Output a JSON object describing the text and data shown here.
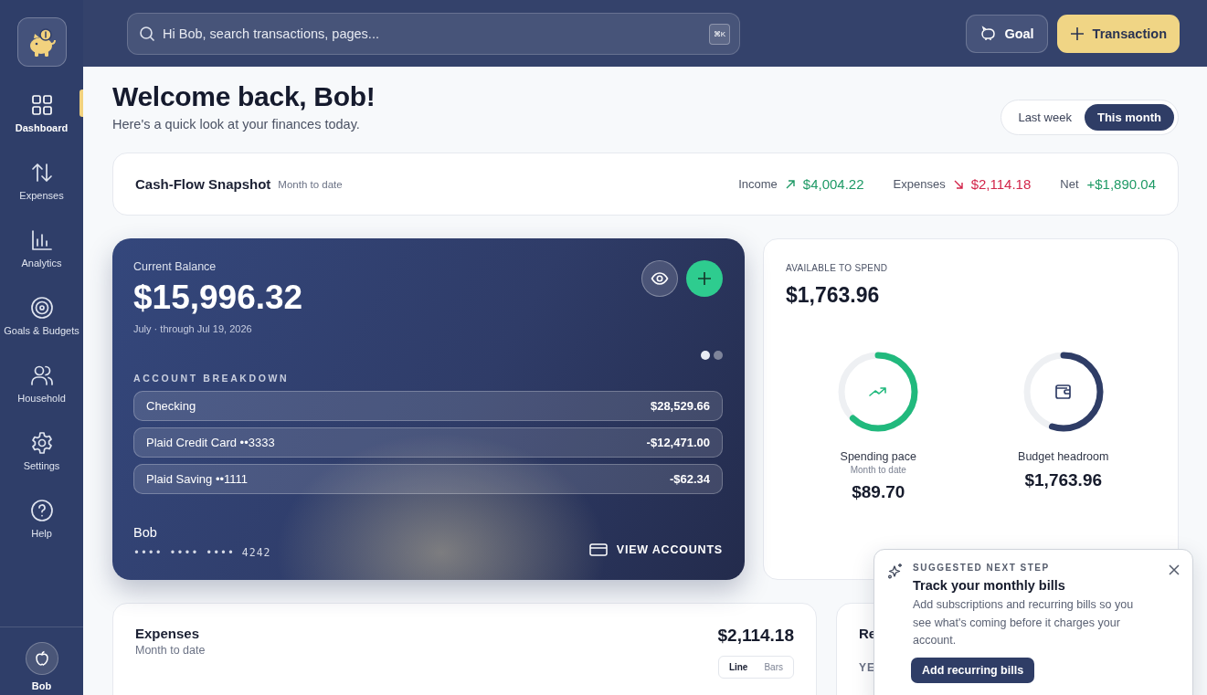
{
  "sidebar": {
    "items": [
      {
        "label": "Dashboard",
        "kind": "grid",
        "selected": true
      },
      {
        "label": "Expenses",
        "kind": "arrows",
        "selected": false
      },
      {
        "label": "Analytics",
        "kind": "chart",
        "selected": false
      },
      {
        "label": "Goals & Budgets",
        "kind": "target",
        "selected": false
      },
      {
        "label": "Household",
        "kind": "people",
        "selected": false
      },
      {
        "label": "Settings",
        "kind": "gear",
        "selected": false
      },
      {
        "label": "Help",
        "kind": "help",
        "selected": false
      }
    ],
    "user": {
      "name": "Bob"
    }
  },
  "topbar": {
    "search": {
      "placeholder": "Hi Bob, search transactions, pages...",
      "shortcut": "⌘K"
    },
    "buttons": [
      {
        "label": "Goal",
        "kind": "secondary"
      },
      {
        "label": "Transaction",
        "kind": "primary"
      }
    ]
  },
  "header": {
    "title": "Welcome back, Bob!",
    "subtitle": "Here's a quick look at your finances today.",
    "range_tabs": [
      {
        "label": "Last week",
        "selected": false
      },
      {
        "label": "This month",
        "selected": true
      }
    ]
  },
  "cash_flow": {
    "title": "Cash-Flow Snapshot",
    "period": "Month to date",
    "items": [
      {
        "label": "Income",
        "value": "$4,004.22",
        "kind": "income"
      },
      {
        "label": "Expenses",
        "value": "$2,114.18",
        "kind": "expense"
      },
      {
        "label": "Net",
        "value": "+$1,890.04",
        "kind": "net"
      }
    ]
  },
  "balance_card": {
    "label": "Current Balance",
    "amount": "$15,996.32",
    "period": "July · through Jul 19, 2026",
    "pages": [
      {
        "selected": true
      },
      {
        "selected": false
      }
    ],
    "breakdown_title": "ACCOUNT BREAKDOWN",
    "accounts": [
      {
        "name": "Checking",
        "value": "$28,529.66"
      },
      {
        "name": "Plaid Credit Card ••3333",
        "value": "-$12,471.00"
      },
      {
        "name": "Plaid Saving ••1111",
        "value": "-$62.34"
      }
    ],
    "holder": "Bob",
    "card_number": "•••• •••• •••• 4242",
    "action": "VIEW ACCOUNTS"
  },
  "available": {
    "label": "AVAILABLE TO SPEND",
    "amount": "$1,763.96",
    "meters": [
      {
        "label": "Spending pace",
        "sublabel": "Month to date",
        "value": "$89.70",
        "level": 0.62,
        "kind": "pace"
      },
      {
        "label": "Budget headroom",
        "value": "$1,763.96",
        "level": 0.55,
        "kind": "budget"
      }
    ]
  },
  "expenses": {
    "title": "Expenses",
    "subtitle": "Month to date",
    "total": "$2,114.18",
    "view_tabs": [
      {
        "label": "Line",
        "selected": true
      },
      {
        "label": "Bars",
        "selected": false
      }
    ]
  },
  "card_2": {
    "title": "Re",
    "label": "YE"
  },
  "suggestion": {
    "eyebrow": "SUGGESTED NEXT STEP",
    "title": "Track your monthly bills",
    "body": "Add subscriptions and recurring bills so you see what's coming before it charges your account.",
    "action": "Add recurring bills"
  }
}
